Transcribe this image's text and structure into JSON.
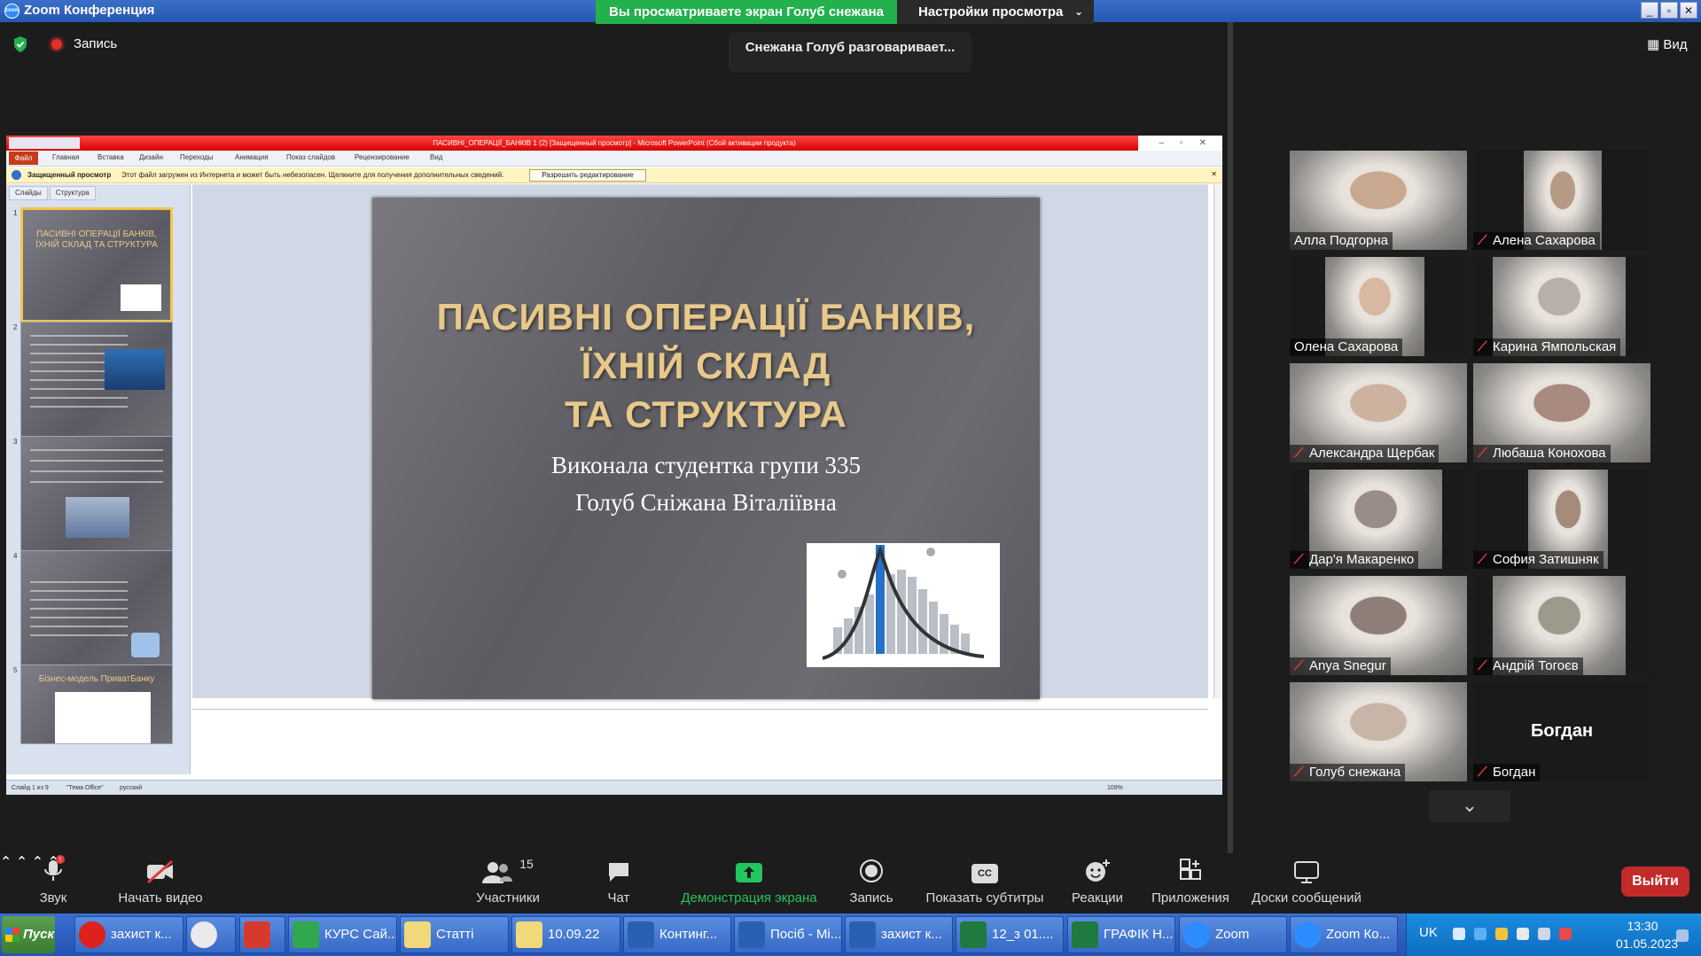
{
  "window": {
    "title": "Zoom Конференция",
    "zoom_logo_text": "zoom"
  },
  "share_banner": {
    "text": "Вы просматриваете экран Голуб снежана",
    "view_settings": "Настройки просмотра"
  },
  "top": {
    "recording_label": "Запись",
    "speaking_toast": "Снежана Голуб разговаривает...",
    "view_label": "Вид"
  },
  "powerpoint": {
    "title": "ПАСИВНІ_ОПЕРАЦІЇ_БАНКІВ 1 (2) [Защищенный просмотр] - Microsoft PowerPoint (Сбой активации продукта)",
    "ribbon_tabs": [
      "Файл",
      "Главная",
      "Вставка",
      "Дизайн",
      "Переходы",
      "Анимация",
      "Показ слайдов",
      "Рецензирование",
      "Вид"
    ],
    "protected_label": "Защищенный просмотр",
    "protected_msg": "Этот файл загружен из Интернета и может быть небезопасен. Щелкните для получения дополнительных сведений.",
    "protected_button": "Разрешить редактирование",
    "pane_tabs": [
      "Слайды",
      "Структура"
    ],
    "thumbnails": [
      {
        "num": "1",
        "title": "ПАСИВНІ ОПЕРАЦІЇ БАНКІВ, ЇХНІЙ СКЛАД ТА СТРУКТУРА"
      },
      {
        "num": "2",
        "title": ""
      },
      {
        "num": "3",
        "title": ""
      },
      {
        "num": "4",
        "title": ""
      },
      {
        "num": "5",
        "title": "Бізнес-модель ПриватБанку"
      }
    ],
    "slide": {
      "title_line1": "ПАСИВНІ ОПЕРАЦІЇ БАНКІВ,",
      "title_line2": "ЇХНІЙ СКЛАД",
      "title_line3": "ТА СТРУКТУРА",
      "subtitle_line1": "Виконала студентка групи 335",
      "subtitle_line2": "Голуб Сніжана Віталіївна"
    },
    "status": {
      "slide": "Слайд 1 из 9",
      "theme": "\"Тема Office\"",
      "lang": "русский",
      "zoom": "109%"
    }
  },
  "participants": [
    {
      "name": "Алла Подгорна",
      "muted": false,
      "tone": "#c9a890"
    },
    {
      "name": "Алена Сахарова",
      "muted": true,
      "tone": "#b59a86"
    },
    {
      "name": "Олена Сахарова",
      "muted": false,
      "tone": "#d8b8a0"
    },
    {
      "name": "Карина Ямпольская",
      "muted": true,
      "tone": "#b7afa8"
    },
    {
      "name": "Александра Щербак",
      "muted": true,
      "tone": "#cdb2a0"
    },
    {
      "name": "Любаша  Конохова",
      "muted": true,
      "tone": "#a88a7e"
    },
    {
      "name": "Дар'я Макаренко",
      "muted": true,
      "tone": "#9a8c88"
    },
    {
      "name": "София Затишняк",
      "muted": true,
      "tone": "#a48b7a"
    },
    {
      "name": "Anya Snegur",
      "muted": true,
      "tone": "#8f7d78"
    },
    {
      "name": "Андрій Тогоєв",
      "muted": true,
      "tone": "#9c9a8a"
    },
    {
      "name": "Голуб снежана",
      "muted": true,
      "tone": "#c9b5a7"
    },
    {
      "name": "Богдан",
      "muted": true,
      "tone": "",
      "big_name": "Богдан"
    }
  ],
  "toolbar": {
    "audio": "Звук",
    "video": "Начать видео",
    "participants": "Участники",
    "participants_count": "15",
    "chat": "Чат",
    "share": "Демонстрация экрана",
    "record": "Запись",
    "captions": "Показать субтитры",
    "captions_icon": "CC",
    "reactions": "Реакции",
    "apps": "Приложения",
    "whiteboards": "Доски сообщений",
    "leave": "Выйти"
  },
  "taskbar": {
    "start": "Пуск",
    "items": [
      "захист к...",
      "",
      "",
      "КУРС Сай...",
      "Статті",
      "10.09.22",
      "Континг...",
      "Посіб - Мі...",
      "захист к...",
      "12_з 01....",
      "ГРАФІК Н...",
      "Zoom",
      "Zoom Ко..."
    ],
    "lang": "UK",
    "time": "13:30",
    "date": "01.05.2023"
  },
  "colors": {
    "banner_green": "#22b14c",
    "share_green": "#22c55e",
    "leave_red": "#c32a2a",
    "mute_red": "#e43b3b",
    "slide_title_gold": "#e8c98a"
  }
}
